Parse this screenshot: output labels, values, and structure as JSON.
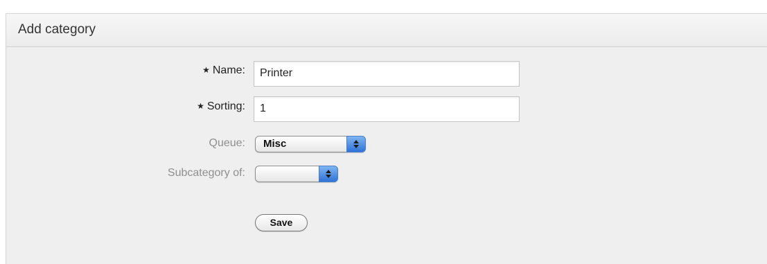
{
  "panel": {
    "title": "Add category"
  },
  "form": {
    "required_marker": "★",
    "name": {
      "label": "Name:",
      "value": "Printer"
    },
    "sorting": {
      "label": "Sorting:",
      "value": "1"
    },
    "queue": {
      "label": "Queue:",
      "selected": "Misc"
    },
    "subcategory": {
      "label": "Subcategory of:",
      "selected": ""
    },
    "save_label": "Save"
  },
  "icons": {
    "select_arrow": "updown-chevron-icon",
    "required": "star-icon"
  },
  "colors": {
    "panel_bg": "#efefef",
    "header_bg": "#f2f2f2",
    "select_arrow": "#3a7ee0",
    "optional_label": "#8f8f8f"
  }
}
